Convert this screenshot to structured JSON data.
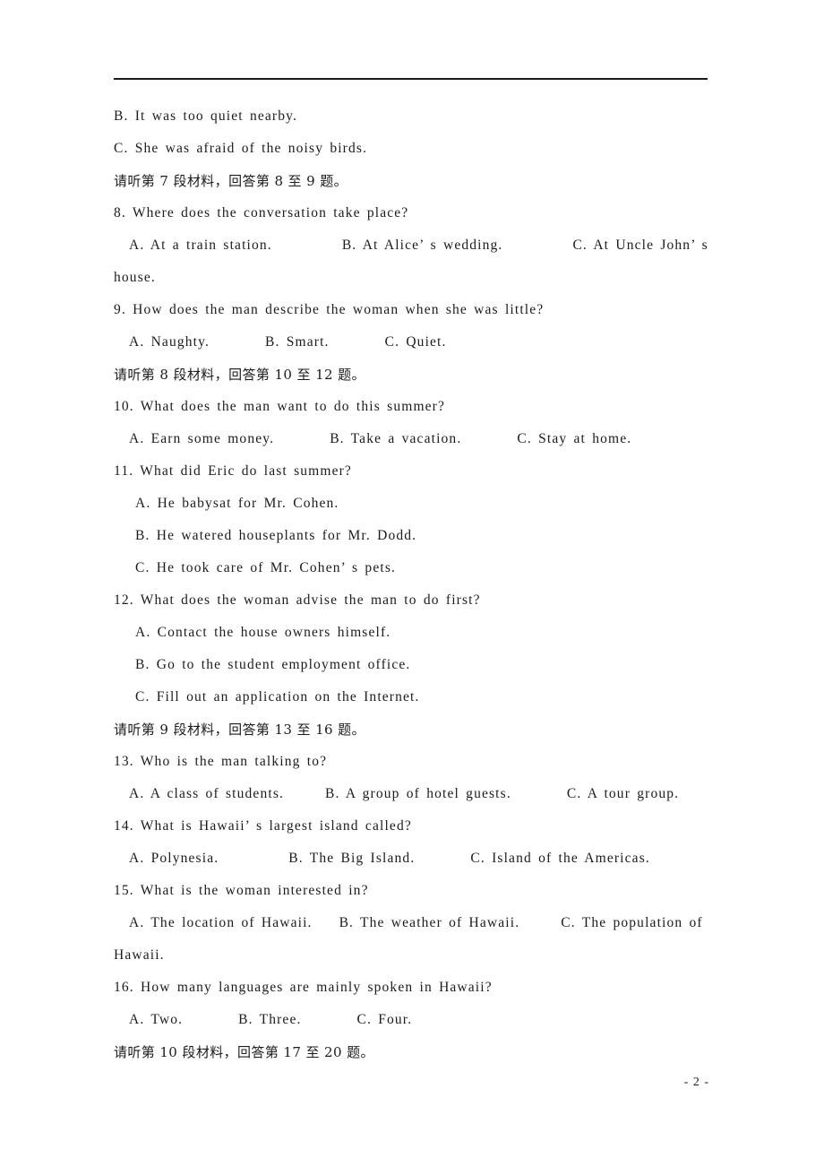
{
  "document": {
    "page_number_label": "- 2 -",
    "has_header_rule": true,
    "ink_color": "#1b1b1b",
    "paper_color": "#ffffff"
  },
  "lines": [
    {
      "id": "l01",
      "kind": "en",
      "indent": 0,
      "text": "B. It was too quiet nearby."
    },
    {
      "id": "l02",
      "kind": "en",
      "indent": 0,
      "text": "C. She was afraid of the noisy birds."
    },
    {
      "id": "l03",
      "kind": "cn",
      "indent": 0,
      "text": "请听第 7 段材料，回答第 8 至 9 题。"
    },
    {
      "id": "l04",
      "kind": "en",
      "indent": 0,
      "text": "8. Where does the conversation take place?"
    },
    {
      "id": "l05",
      "kind": "opts",
      "indent": 1,
      "a": "A. At a train station.",
      "b": "B. At Alice’ s wedding.",
      "c": "C. At Uncle John’ s",
      "gap1": "g-xl",
      "gap2": "g-xl"
    },
    {
      "id": "l06",
      "kind": "en",
      "indent": 0,
      "text": "house."
    },
    {
      "id": "l07",
      "kind": "en",
      "indent": 0,
      "text": "9. How does the man describe the woman when she was little?"
    },
    {
      "id": "l08",
      "kind": "opts",
      "indent": 1,
      "a": "A. Naughty.",
      "b": "B. Smart.",
      "c": "C. Quiet.",
      "gap1": "g-lg",
      "gap2": "g-lg"
    },
    {
      "id": "l09",
      "kind": "cn",
      "indent": 0,
      "text": "请听第 8 段材料，回答第 10 至 12 题。"
    },
    {
      "id": "l10",
      "kind": "en",
      "indent": 0,
      "text": "10. What does the man want to do this summer?"
    },
    {
      "id": "l11",
      "kind": "opts",
      "indent": 1,
      "a": "A. Earn some money.",
      "b": "B. Take a vacation.",
      "c": "C. Stay at home.",
      "gap1": "g-lg",
      "gap2": "g-lg"
    },
    {
      "id": "l12",
      "kind": "en",
      "indent": 0,
      "text": "11. What did Eric do last summer?"
    },
    {
      "id": "l13",
      "kind": "en",
      "indent": 2,
      "text": "A. He babysat for Mr. Cohen."
    },
    {
      "id": "l14",
      "kind": "en",
      "indent": 2,
      "text": "B. He watered houseplants for Mr. Dodd."
    },
    {
      "id": "l15",
      "kind": "en",
      "indent": 2,
      "text": "C. He took care of Mr. Cohen’ s pets."
    },
    {
      "id": "l16",
      "kind": "en",
      "indent": 0,
      "text": "12. What does the woman advise the man to do first?"
    },
    {
      "id": "l17",
      "kind": "en",
      "indent": 2,
      "text": "A. Contact the house owners himself."
    },
    {
      "id": "l18",
      "kind": "en",
      "indent": 2,
      "text": "B. Go to the student employment office."
    },
    {
      "id": "l19",
      "kind": "en",
      "indent": 2,
      "text": "C. Fill out an application on the Internet."
    },
    {
      "id": "l20",
      "kind": "cn",
      "indent": 0,
      "text": "请听第 9 段材料，回答第 13 至 16 题。"
    },
    {
      "id": "l21",
      "kind": "en",
      "indent": 0,
      "text": "13. Who is the man talking to?"
    },
    {
      "id": "l22",
      "kind": "opts",
      "indent": 1,
      "a": "A. A class of students.",
      "b": "B. A group of hotel guests.",
      "c": "C. A tour group.",
      "gap1": "g-md",
      "gap2": "g-lg"
    },
    {
      "id": "l23",
      "kind": "en",
      "indent": 0,
      "text": "14. What is Hawaii’ s largest island called?"
    },
    {
      "id": "l24",
      "kind": "opts",
      "indent": 1,
      "a": "A. Polynesia.",
      "b": "B. The Big Island.",
      "c": "C. Island of the Americas.",
      "gap1": "g-xl",
      "gap2": "g-lg"
    },
    {
      "id": "l25",
      "kind": "en",
      "indent": 0,
      "text": "15. What is the woman interested in?"
    },
    {
      "id": "l26",
      "kind": "opts",
      "indent": 1,
      "a": "A. The location of Hawaii.",
      "b": "B. The weather of Hawaii.",
      "c": "C. The population of",
      "gap1": "g-sm",
      "gap2": "g-md"
    },
    {
      "id": "l27",
      "kind": "en",
      "indent": 0,
      "text": "Hawaii."
    },
    {
      "id": "l28",
      "kind": "en",
      "indent": 0,
      "text": "16. How many languages are mainly spoken in Hawaii?"
    },
    {
      "id": "l29",
      "kind": "opts",
      "indent": 1,
      "a": "A. Two.",
      "b": "B. Three.",
      "c": "C. Four.",
      "gap1": "g-lg",
      "gap2": "g-lg"
    },
    {
      "id": "l30",
      "kind": "cn",
      "indent": 0,
      "text": "请听第 10 段材料，回答第 17 至 20 题。"
    }
  ]
}
